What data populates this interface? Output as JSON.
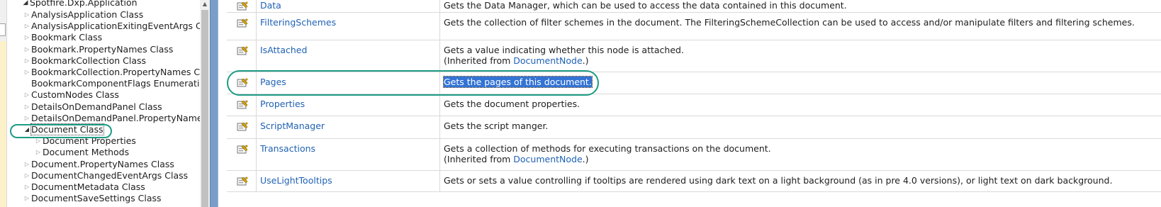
{
  "tree": {
    "root": "Spotfire.Dxp.Application",
    "items": [
      {
        "label": "AnalysisApplication Class",
        "indent": 1,
        "arrow": "▷"
      },
      {
        "label": "AnalysisApplicationExitingEventArgs Clas",
        "indent": 1,
        "arrow": "▷"
      },
      {
        "label": "Bookmark Class",
        "indent": 1,
        "arrow": "▷"
      },
      {
        "label": "Bookmark.PropertyNames Class",
        "indent": 1,
        "arrow": "▷"
      },
      {
        "label": "BookmarkCollection Class",
        "indent": 1,
        "arrow": "▷"
      },
      {
        "label": "BookmarkCollection.PropertyNames Clas",
        "indent": 1,
        "arrow": "▷"
      },
      {
        "label": "BookmarkComponentFlags Enumeration",
        "indent": 1,
        "arrow": ""
      },
      {
        "label": "CustomNodes Class",
        "indent": 1,
        "arrow": "▷"
      },
      {
        "label": "DetailsOnDemandPanel Class",
        "indent": 1,
        "arrow": "▷"
      },
      {
        "label": "DetailsOnDemandPanel.PropertyNames C",
        "indent": 1,
        "arrow": "▷"
      },
      {
        "label": "Document Class",
        "indent": 1,
        "arrow": "◢",
        "selected": true
      },
      {
        "label": "Document Properties",
        "indent": 2,
        "arrow": "▷"
      },
      {
        "label": "Document Methods",
        "indent": 2,
        "arrow": "▷"
      },
      {
        "label": "Document.PropertyNames Class",
        "indent": 1,
        "arrow": "▷"
      },
      {
        "label": "DocumentChangedEventArgs Class",
        "indent": 1,
        "arrow": "▷"
      },
      {
        "label": "DocumentMetadata Class",
        "indent": 1,
        "arrow": "▷"
      },
      {
        "label": "DocumentSaveSettings Class",
        "indent": 1,
        "arrow": "▷"
      }
    ]
  },
  "members": [
    {
      "name": "Data",
      "desc": "Gets the Data Manager, which can be used to access the data contained in this document."
    },
    {
      "name": "FilteringSchemes",
      "desc": "Gets the collection of filter schemes in the document. The FilteringSchemeCollection can be used to access and/or manipulate filters and filtering schemes."
    },
    {
      "name": "IsAttached",
      "desc": "Gets a value indicating whether this node is attached.",
      "inherited_prefix": "(Inherited from ",
      "inherited_link": "DocumentNode",
      "inherited_suffix": ".)"
    },
    {
      "name": "Pages",
      "desc": "Gets the pages of this document."
    },
    {
      "name": "Properties",
      "desc": "Gets the document properties."
    },
    {
      "name": "ScriptManager",
      "desc": "Gets the script manger."
    },
    {
      "name": "Transactions",
      "desc": "Gets a collection of methods for executing transactions on the document.",
      "inherited_prefix": "(Inherited from ",
      "inherited_link": "DocumentNode",
      "inherited_suffix": ".)"
    },
    {
      "name": "UseLightTooltips",
      "desc": "Gets or sets a value controlling if tooltips are rendered using dark text on a light background (as in pre 4.0 versions), or light text on dark background."
    }
  ],
  "colors": {
    "link": "#1f62b4",
    "highlight_circle": "#1e9c84",
    "selection": "#3373d5",
    "splitter": "#7b9ec8"
  },
  "icons": {
    "property": "property-icon",
    "tree_expand": "triangle-right-outline",
    "tree_collapse": "triangle-down-filled"
  }
}
